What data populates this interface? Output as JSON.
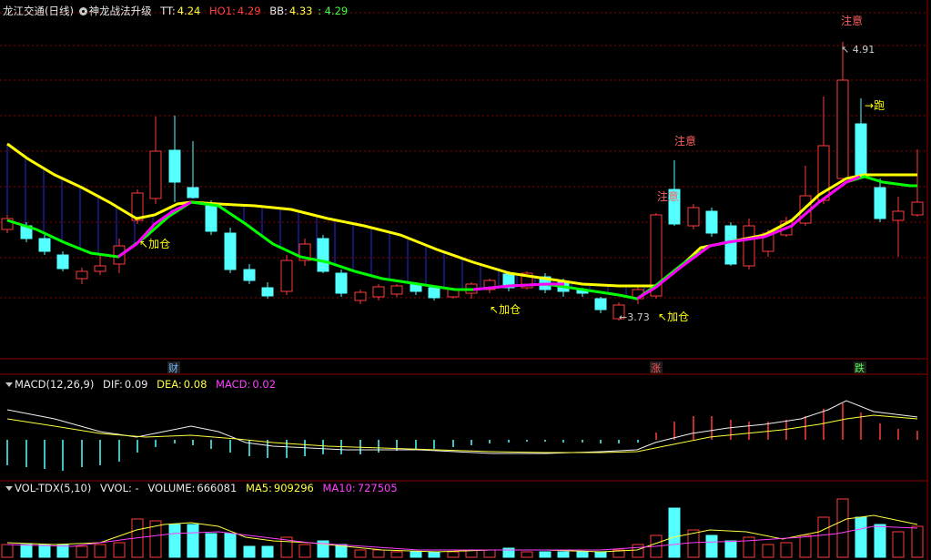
{
  "colors": {
    "up": "#ff3c3c",
    "down": "#54ffff",
    "ttline": "#ffff00",
    "hoLineBull": "#ff00ff",
    "hoLineBear": "#00ff00",
    "grid": "#8b0000",
    "label": "#ffff00"
  },
  "main": {
    "stock_name": "龙江交通(日线)",
    "indicator_name": "神龙战法升级",
    "tt_label": "TT:",
    "tt_value": "4.24",
    "ho1_label": "HO1:",
    "ho1_value": "4.29",
    "bb_label": "BB:",
    "bb_value": "4.33",
    "bb2_value": ": 4.29",
    "markers": {
      "jiacang1": "加仓",
      "jiacang2": "加仓",
      "jiacang3": "加仓",
      "zhuyi1": "注意",
      "zhuyi2": "注意",
      "zhuyi3": "注意",
      "pao": "跑",
      "high_price": "4.91",
      "low_price": "3.73"
    },
    "bottom_tags": {
      "cai": "财",
      "zhang": "涨",
      "die": "跌"
    }
  },
  "macd": {
    "name": "MACD(12,26,9)",
    "dif_label": "DIF:",
    "dif_value": "0.09",
    "dea_label": "DEA:",
    "dea_value": "0.08",
    "macd_label": "MACD:",
    "macd_value": "0.02"
  },
  "vol": {
    "name": "VOL-TDX(5,10)",
    "vvol_label": "VVOL: -",
    "volume_label": "VOLUME:",
    "volume_value": "666081",
    "ma5_label": "MA5:",
    "ma5_value": "909296",
    "ma10_label": "MA10:",
    "ma10_value": "727505"
  }
}
